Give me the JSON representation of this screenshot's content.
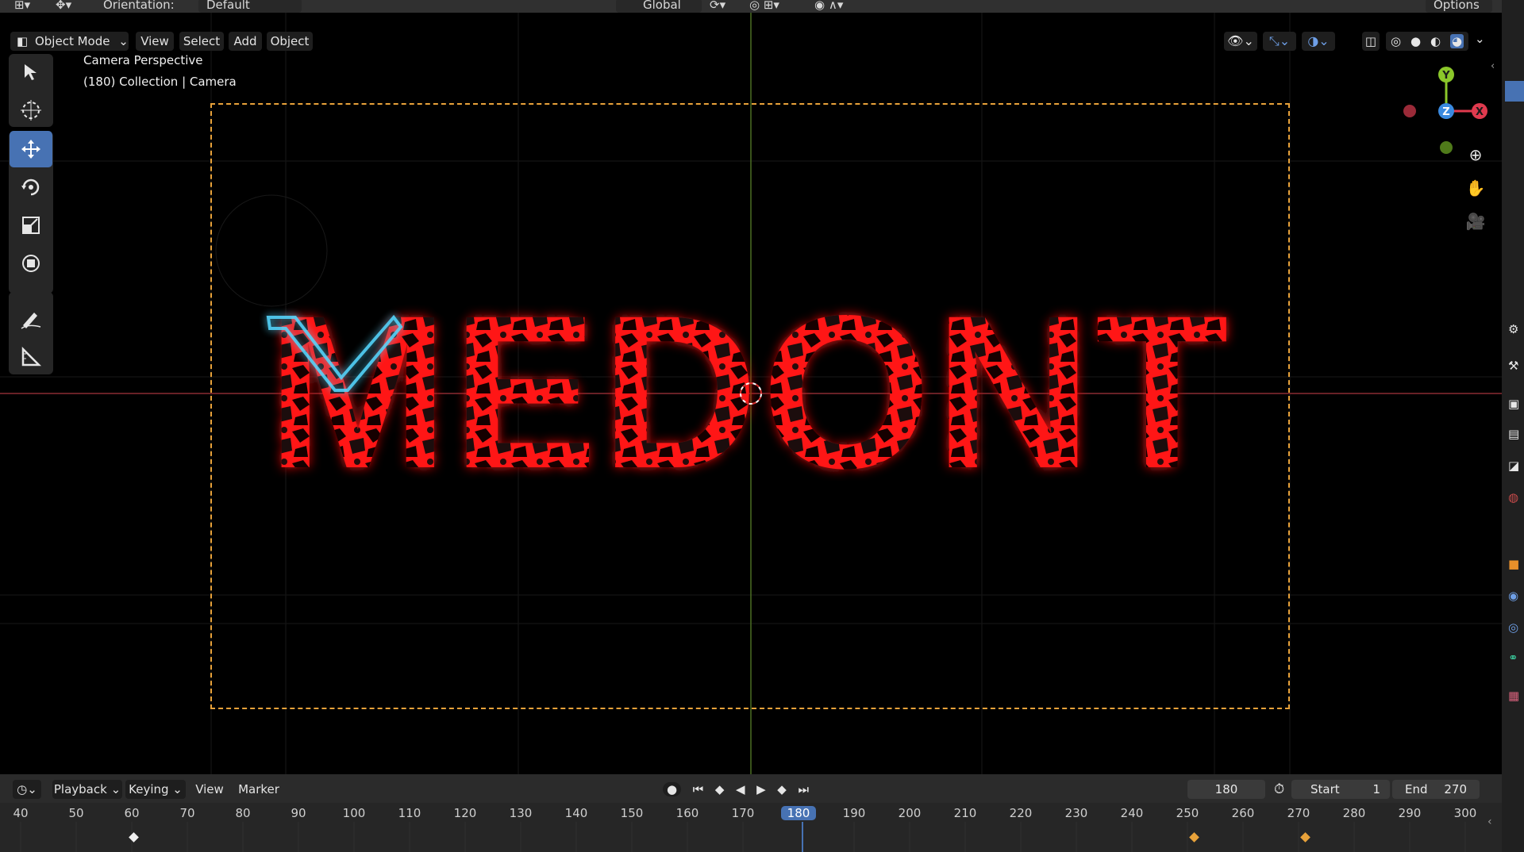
{
  "header": {
    "orientation_label": "Orientation:",
    "orientation_value": "Default",
    "transform_space": "Global",
    "options_label": "Options"
  },
  "viewport_header": {
    "mode": "Object Mode",
    "menus": [
      "View",
      "Select",
      "Add",
      "Object"
    ]
  },
  "viewport": {
    "view_name": "Camera Perspective",
    "collection_info": "(180) Collection | Camera",
    "scene_text": "MEDONT",
    "colors": {
      "accent": "#4772b3",
      "camera_frame": "#e8a23a",
      "text_red": "#ff1414",
      "text_glow": "#50d2ff"
    }
  },
  "gizmo": {
    "y": "Y",
    "x": "X",
    "z": "Z"
  },
  "tools": [
    {
      "name": "select-icon",
      "active": false
    },
    {
      "name": "cursor-icon",
      "active": false
    },
    {
      "name": "move-icon",
      "active": true
    },
    {
      "name": "rotate-icon",
      "active": false
    },
    {
      "name": "scale-icon",
      "active": false
    },
    {
      "name": "transform-icon",
      "active": false
    },
    {
      "name": "annotate-icon",
      "active": false
    },
    {
      "name": "measure-icon",
      "active": false
    }
  ],
  "timeline": {
    "menus": [
      "Playback",
      "Keying",
      "View",
      "Marker"
    ],
    "current_frame": "180",
    "start_label": "Start",
    "start_value": "1",
    "end_label": "End",
    "end_value": "270",
    "ticks": [
      "40",
      "50",
      "60",
      "70",
      "80",
      "90",
      "100",
      "110",
      "120",
      "130",
      "140",
      "150",
      "160",
      "170",
      "180",
      "190",
      "200",
      "210",
      "220",
      "230",
      "240",
      "250",
      "260",
      "270",
      "280",
      "290",
      "300"
    ]
  }
}
